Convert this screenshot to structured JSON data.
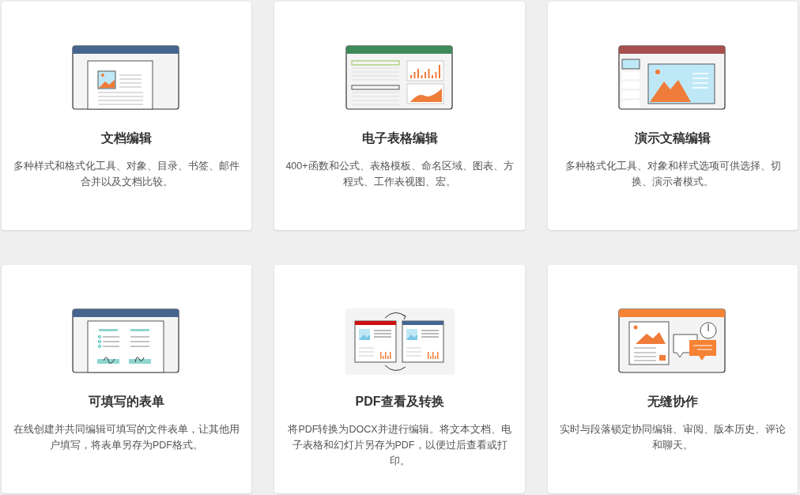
{
  "cards": [
    {
      "kind": "document",
      "title": "文档编辑",
      "description": "多种样式和格式化工具、对象、目录、书签、邮件合并以及文档比较。"
    },
    {
      "kind": "spreadsheet",
      "title": "电子表格编辑",
      "description": "400+函数和公式、表格模板、命名区域、图表、方程式、工作表视图、宏。"
    },
    {
      "kind": "presentation",
      "title": "演示文稿编辑",
      "description": "多种格式化工具、对象和样式选项可供选择、切换、演示者模式。"
    },
    {
      "kind": "form",
      "title": "可填写的表单",
      "description": "在线创建并共同编辑可填写的文件表单，让其他用户填写，将表单另存为PDF格式。"
    },
    {
      "kind": "pdf",
      "title": "PDF查看及转换",
      "description": "将PDF转换为DOCX并进行编辑。将文本文档、电子表格和幻灯片另存为PDF，以便过后查看或打印。"
    },
    {
      "kind": "collaboration",
      "title": "无缝协作",
      "description": "实时与段落锁定协同编辑、审阅、版本历史、评论和聊天。"
    }
  ]
}
